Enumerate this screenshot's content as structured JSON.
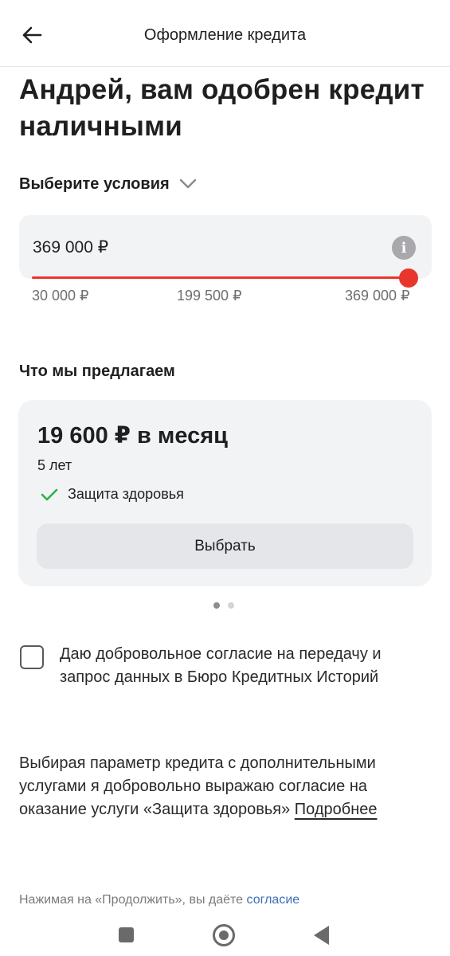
{
  "header": {
    "title": "Оформление кредита",
    "back_icon": "arrow-left-icon"
  },
  "headline": "Андрей, вам одобрен кредит наличными",
  "conditions": {
    "label": "Выберите условия",
    "icon": "chevron-down-icon"
  },
  "amount": {
    "value": "369 000 ₽",
    "info_icon": "info-icon",
    "info_glyph": "i",
    "slider_fraction": 1.0,
    "scale_labels": [
      "30 000 ₽",
      "199 500 ₽",
      "369 000 ₽"
    ],
    "accent_color": "#e8362c"
  },
  "offers": {
    "heading": "Что мы предлагаем",
    "card": {
      "price": "19 600 ₽ в месяц",
      "term": "5 лет",
      "feature": "Защита здоровья",
      "feature_icon": "check-icon",
      "feature_icon_color": "#2bb24c",
      "select_label": "Выбрать"
    },
    "pager": {
      "count": 2,
      "active": 0
    }
  },
  "consent": {
    "checked": false,
    "text": "Даю добровольное согласие на передачу и запрос данных в Бюро Кредитных Историй"
  },
  "disclaimer": {
    "text": "Выбирая параметр кредита с дополнительными услугами я добровольно выражаю согласие на оказание услуги «Защита здоровья»",
    "link": "Подробнее"
  },
  "footer": {
    "text": "Нажимая на «Продолжить», вы даёте",
    "link": "согласие",
    "link_color": "#3b6fb6"
  },
  "system_nav": {
    "recents_icon": "recents-square-icon",
    "home_icon": "home-circle-icon",
    "back_icon": "back-triangle-icon"
  }
}
